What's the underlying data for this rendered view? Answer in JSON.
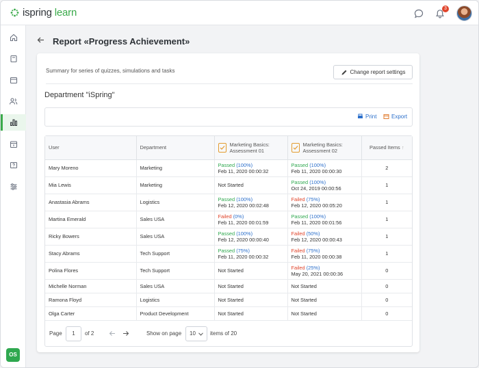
{
  "app": {
    "logo_text_a": "ispring",
    "logo_text_b": " learn",
    "notification_count": "3",
    "user_initials": "OS"
  },
  "colors": {
    "brand_green": "#3aaa4a",
    "passed": "#2fa84f",
    "failed": "#e0452c",
    "link_blue": "#2b6fcb"
  },
  "sidebar": {
    "icons": [
      "home-icon",
      "book-icon",
      "calendar-icon",
      "users-icon",
      "reports-icon",
      "calendar-day-icon",
      "help-icon",
      "settings-sliders-icon"
    ],
    "active": "reports-icon"
  },
  "header": {
    "title": "Report «Progress Achievement»"
  },
  "summary": {
    "text": "Summary for series of quizzes, simulations and tasks",
    "change_button": "Change report settings"
  },
  "department": {
    "title": "Department \"iSpring\""
  },
  "toolbar": {
    "print": "Print",
    "export": "Export"
  },
  "table": {
    "columns": {
      "user": "User",
      "department": "Department",
      "q1_line1": "Marketing Basics:",
      "q1_line2": "Assessment 01",
      "q2_line1": "Marketing Basics:",
      "q2_line2": "Assessment 02",
      "passed": "Passed Items"
    },
    "rows": [
      {
        "user": "Mary Moreno",
        "department": "Marketing",
        "q1": {
          "status": "Passed",
          "pct": "(100%)",
          "date": "Feb 11, 2020 00:00:32"
        },
        "q2": {
          "status": "Passed",
          "pct": "(100%)",
          "date": "Feb 11, 2020 00:00:30"
        },
        "passed": "2"
      },
      {
        "user": "Mia Lewis",
        "department": "Marketing",
        "q1": {
          "status": "Not Started"
        },
        "q2": {
          "status": "Passed",
          "pct": "(100%)",
          "date": "Oct 24, 2019 00:00:56"
        },
        "passed": "1"
      },
      {
        "user": "Anastasia Abrams",
        "department": "Logistics",
        "q1": {
          "status": "Passed",
          "pct": "(100%)",
          "date": "Feb 12, 2020 00:02:48"
        },
        "q2": {
          "status": "Failed",
          "pct": "(75%)",
          "date": "Feb 12, 2020 00:05:20"
        },
        "passed": "1"
      },
      {
        "user": "Martina Emerald",
        "department": "Sales USA",
        "q1": {
          "status": "Failed",
          "pct": "(0%)",
          "date": "Feb 11, 2020 00:01:59"
        },
        "q2": {
          "status": "Passed",
          "pct": "(100%)",
          "date": "Feb 11, 2020 00:01:56"
        },
        "passed": "1"
      },
      {
        "user": "Ricky Bowers",
        "department": "Sales USA",
        "q1": {
          "status": "Passed",
          "pct": "(100%)",
          "date": "Feb 12, 2020 00:00:40"
        },
        "q2": {
          "status": "Failed",
          "pct": "(50%)",
          "date": "Feb 12, 2020 00:00:43"
        },
        "passed": "1"
      },
      {
        "user": "Stacy Abrams",
        "department": "Tech Support",
        "q1": {
          "status": "Passed",
          "pct": "(75%)",
          "date": "Feb 11, 2020 00:00:32"
        },
        "q2": {
          "status": "Failed",
          "pct": "(75%)",
          "date": "Feb 11, 2020 00:00:38"
        },
        "passed": "1"
      },
      {
        "user": "Polina Flores",
        "department": "Tech Support",
        "q1": {
          "status": "Not Started"
        },
        "q2": {
          "status": "Failed",
          "pct": "(25%)",
          "date": "May 20, 2021 00:00:36"
        },
        "passed": "0"
      },
      {
        "user": "Michelle Norman",
        "department": "Sales USA",
        "q1": {
          "status": "Not Started"
        },
        "q2": {
          "status": "Not Started"
        },
        "passed": "0"
      },
      {
        "user": "Ramona Floyd",
        "department": "Logistics",
        "q1": {
          "status": "Not Started"
        },
        "q2": {
          "status": "Not Started"
        },
        "passed": "0"
      },
      {
        "user": "Olga Carter",
        "department": "Product Development",
        "q1": {
          "status": "Not Started"
        },
        "q2": {
          "status": "Not Started"
        },
        "passed": "0"
      }
    ]
  },
  "pager": {
    "page_label": "Page",
    "page_value": "1",
    "of_label": "of 2",
    "show_label": "Show on page",
    "per_page": "10",
    "items_label": "items of 20"
  }
}
